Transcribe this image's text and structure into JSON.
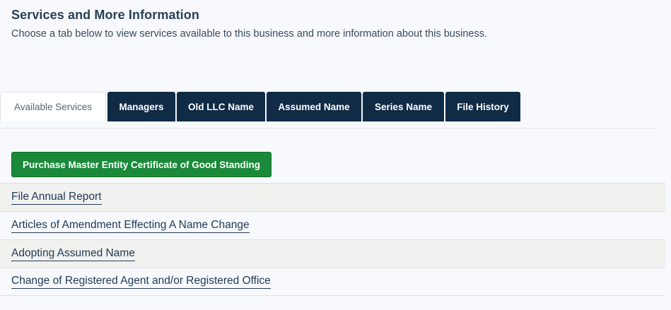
{
  "section": {
    "title": "Services and More Information",
    "subtitle": "Choose a tab below to view services available to this business and more information about this business."
  },
  "tabs": [
    {
      "label": "Available Services",
      "active": true
    },
    {
      "label": "Managers",
      "active": false
    },
    {
      "label": "Old LLC Name",
      "active": false
    },
    {
      "label": "Assumed Name",
      "active": false
    },
    {
      "label": "Series Name",
      "active": false
    },
    {
      "label": "File History",
      "active": false
    }
  ],
  "services": {
    "primary_button_label": "Purchase Master Entity Certificate of Good Standing",
    "links": [
      {
        "label": "File Annual Report"
      },
      {
        "label": "Articles of Amendment Effecting A Name Change"
      },
      {
        "label": "Adopting Assumed Name"
      },
      {
        "label": "Change of Registered Agent and/or Registered Office"
      }
    ]
  },
  "colors": {
    "tab_background": "#0f2b46",
    "primary_button": "#1a8a3a",
    "link_text": "#213a55"
  }
}
